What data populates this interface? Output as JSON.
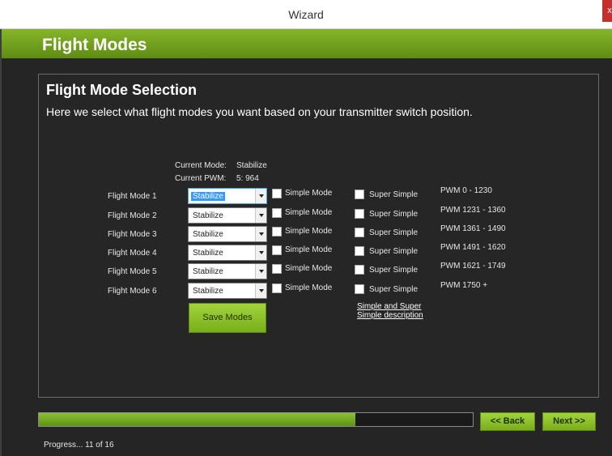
{
  "window": {
    "title": "Wizard",
    "close_glyph": "x"
  },
  "header": {
    "title": "Flight Modes"
  },
  "panel": {
    "title": "Flight Mode Selection",
    "description": "Here we select what flight modes you want based on your transmitter switch position."
  },
  "status": {
    "current_mode_label": "Current Mode:",
    "current_mode_value": "Stabilize",
    "current_pwm_label": "Current PWM:",
    "current_pwm_value": "5: 964"
  },
  "modes": [
    {
      "label": "Flight Mode 1",
      "value": "Stabilize",
      "simple_label": "Simple Mode",
      "super_simple_label": "Super Simple",
      "pwm_range": "PWM 0 - 1230",
      "simple_checked": false,
      "super_simple_checked": false
    },
    {
      "label": "Flight Mode 2",
      "value": "Stabilize",
      "simple_label": "Simple Mode",
      "super_simple_label": "Super Simple",
      "pwm_range": "PWM 1231 - 1360",
      "simple_checked": false,
      "super_simple_checked": false
    },
    {
      "label": "Flight Mode 3",
      "value": "Stabilize",
      "simple_label": "Simple Mode",
      "super_simple_label": "Super Simple",
      "pwm_range": "PWM 1361 - 1490",
      "simple_checked": false,
      "super_simple_checked": false
    },
    {
      "label": "Flight Mode 4",
      "value": "Stabilize",
      "simple_label": "Simple Mode",
      "super_simple_label": "Super Simple",
      "pwm_range": "PWM 1491 - 1620",
      "simple_checked": false,
      "super_simple_checked": false
    },
    {
      "label": "Flight Mode 5",
      "value": "Stabilize",
      "simple_label": "Simple Mode",
      "super_simple_label": "Super Simple",
      "pwm_range": "PWM 1621 - 1749",
      "simple_checked": false,
      "super_simple_checked": false
    },
    {
      "label": "Flight Mode 6",
      "value": "Stabilize",
      "simple_label": "Simple Mode",
      "super_simple_label": "Super Simple",
      "pwm_range": "PWM 1750 +",
      "simple_checked": false,
      "super_simple_checked": false
    }
  ],
  "buttons": {
    "save": "Save Modes",
    "back": "<< Back",
    "next": "Next >>"
  },
  "help_link": {
    "line1": "Simple and Super",
    "line2": "Simple description"
  },
  "progress": {
    "text": "Progress... 11 of 16",
    "current": 11,
    "total": 16,
    "fill_fraction": 0.73
  },
  "colors": {
    "accent": "#7cb41c",
    "background": "#252525",
    "close": "#c6302a"
  }
}
